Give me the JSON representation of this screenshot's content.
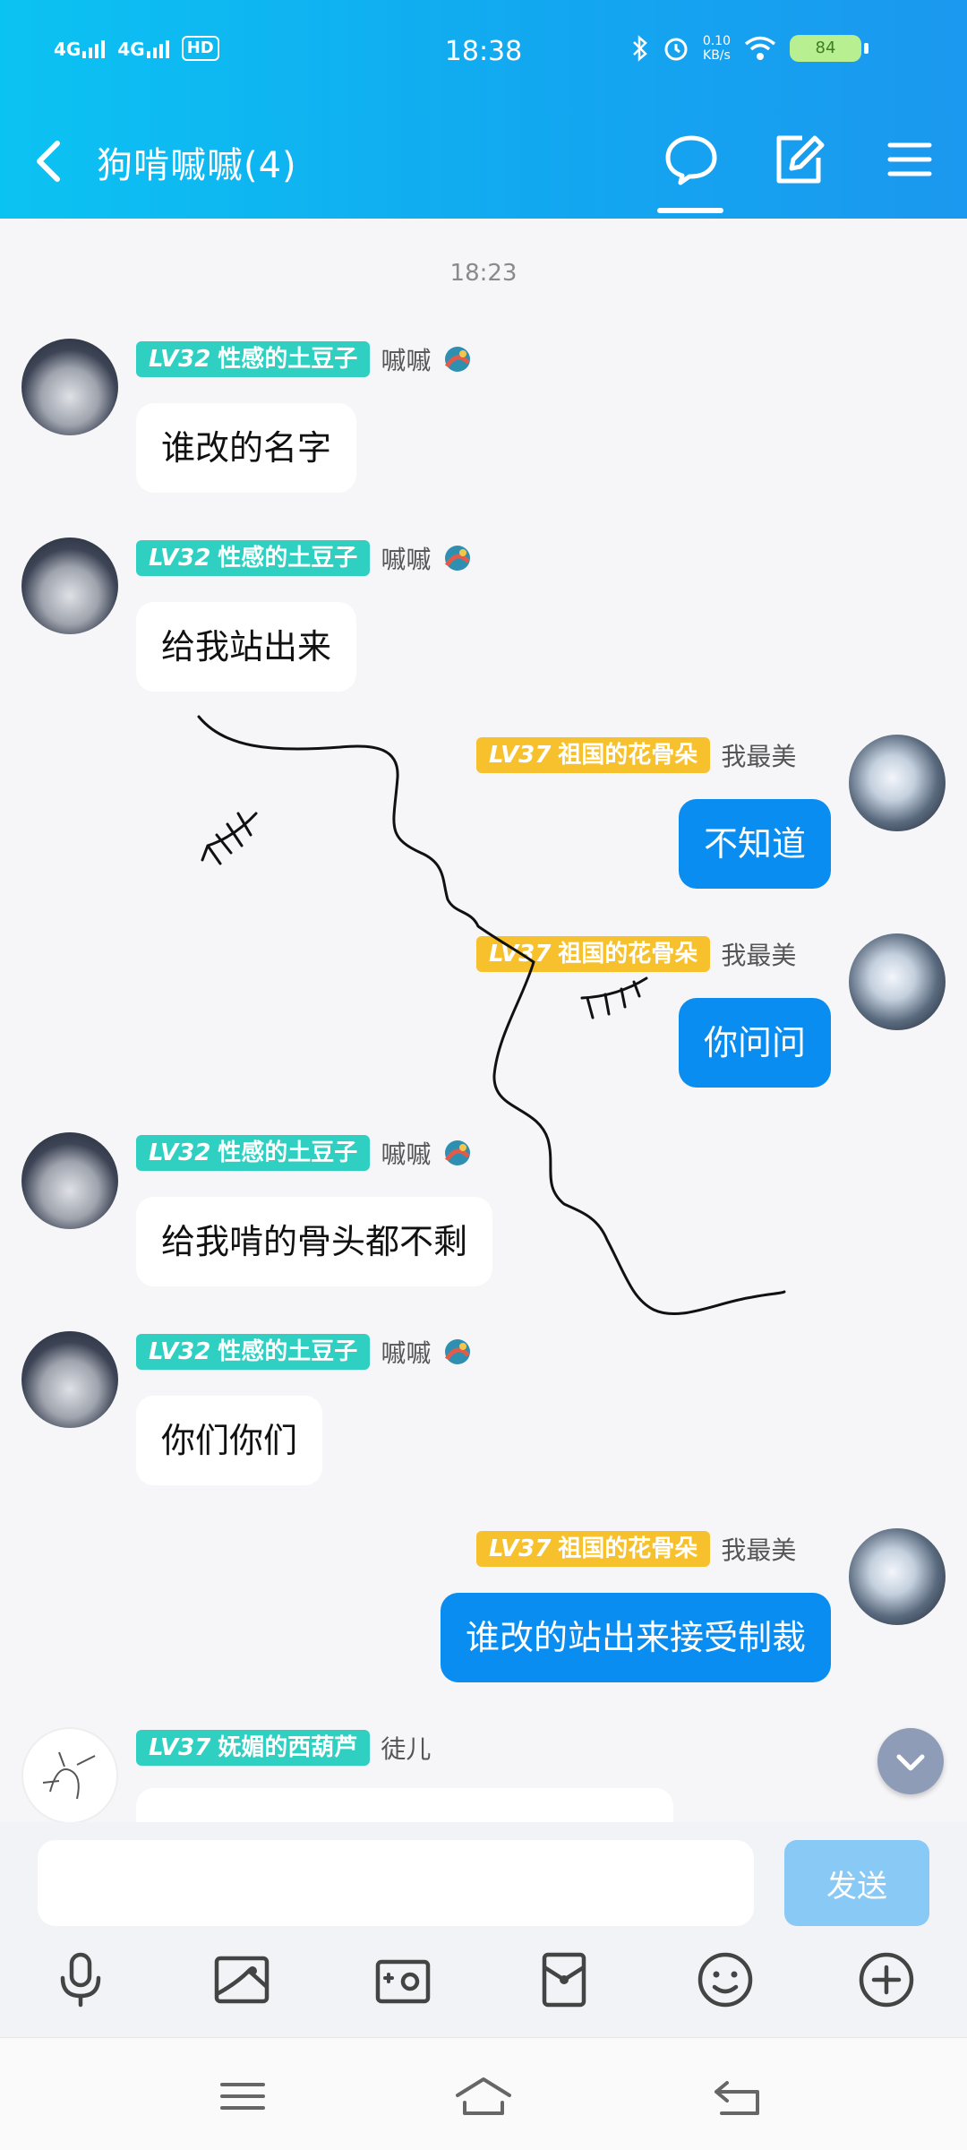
{
  "status_bar": {
    "network_1": "4G",
    "network_2": "4G",
    "hd_label": "HD",
    "time": "18:38",
    "net_speed_value": "0.10",
    "net_speed_unit": "KB/s",
    "battery": "84"
  },
  "header": {
    "title": "狗啃嘁嘁(4)",
    "icons": [
      "back-icon",
      "chat-bubble-icon",
      "edit-icon",
      "menu-icon"
    ],
    "accent_color": "#12a8f0"
  },
  "timestamp": "18:23",
  "messages": [
    {
      "side": "in",
      "level": "LV32",
      "title": "性感的土豆子",
      "nick": "嘁嘁",
      "text": "谁改的名字"
    },
    {
      "side": "in",
      "level": "LV32",
      "title": "性感的土豆子",
      "nick": "嘁嘁",
      "text": "给我站出来"
    },
    {
      "side": "out",
      "level": "LV37",
      "title": "祖国的花骨朵",
      "nick": "我最美",
      "text": "不知道"
    },
    {
      "side": "out",
      "level": "LV37",
      "title": "祖国的花骨朵",
      "nick": "我最美",
      "text": "你问问"
    },
    {
      "side": "in",
      "level": "LV32",
      "title": "性感的土豆子",
      "nick": "嘁嘁",
      "text": "给我啃的骨头都不剩"
    },
    {
      "side": "in",
      "level": "LV32",
      "title": "性感的土豆子",
      "nick": "嘁嘁",
      "text": "你们你们"
    },
    {
      "side": "out",
      "level": "LV37",
      "title": "祖国的花骨朵",
      "nick": "我最美",
      "text": "谁改的站出来接受制裁"
    },
    {
      "side": "in",
      "level": "LV37",
      "title": "妩媚的西葫芦",
      "nick": "徒儿",
      "text": ""
    }
  ],
  "input": {
    "placeholder": "",
    "send_label": "发送"
  },
  "toolbar_icons": [
    "microphone-icon",
    "image-icon",
    "camera-icon",
    "red-packet-icon",
    "emoji-icon",
    "plus-icon"
  ],
  "system_nav_icons": [
    "recent-apps-icon",
    "home-icon",
    "back-nav-icon"
  ],
  "colors": {
    "bubble_out": "#0a8df0",
    "badge_teal": "#2fd0c1",
    "badge_gold": "#f6c12c",
    "send_disabled": "#88c9f6"
  }
}
